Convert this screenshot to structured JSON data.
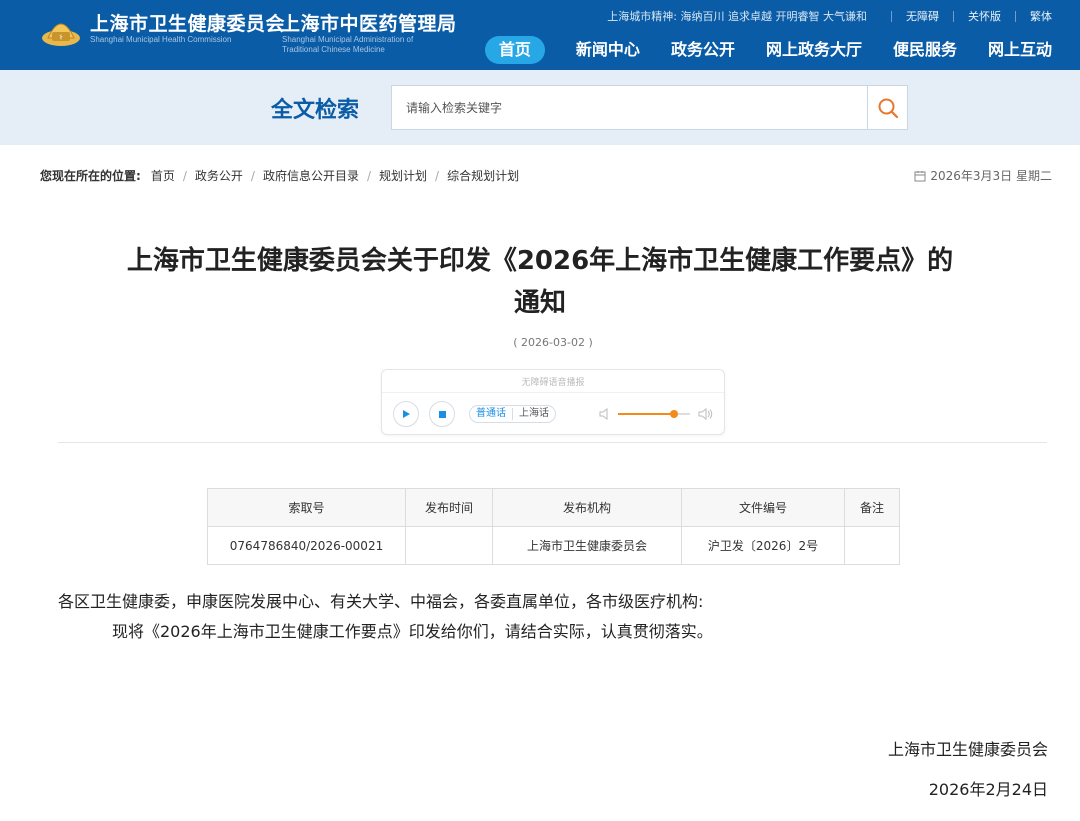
{
  "header": {
    "org_name_1": "上海市卫生健康委员会",
    "org_en_1": "Shanghai Municipal Health Commission",
    "org_name_2": "上海市中医药管理局",
    "org_en_2": "Shanghai Municipal Administration of Traditional Chinese Medicine",
    "slogan": "上海城市精神: 海纳百川 追求卓越 开明睿智 大气谦和",
    "links": [
      "无障碍",
      "关怀版",
      "繁体"
    ],
    "nav": [
      "首页",
      "新闻中心",
      "政务公开",
      "网上政务大厅",
      "便民服务",
      "网上互动"
    ],
    "brand_color": "#0a5ca6",
    "active_nav_color": "#27a7e6"
  },
  "search": {
    "label": "全文检索",
    "placeholder": "请输入检索关键字",
    "button_icon": "search-icon"
  },
  "breadcrumb": {
    "prefix": "您现在所在的位置:",
    "items": [
      "首页",
      "政务公开",
      "政府信息公开目录",
      "规划计划",
      "综合规划计划"
    ]
  },
  "date_display": "2026年3月3日 星期二",
  "article": {
    "title": "上海市卫生健康委员会关于印发《2026年上海市卫生健康工作要点》的通知",
    "date": "( 2026-03-02 )",
    "addressees": "各区卫生健康委，申康医院发展中心、有关大学、中福会，各委直属单位，各市级医疗机构:",
    "body": "现将《2026年上海市卫生健康工作要点》印发给你们，请结合实际，认真贯彻落实。",
    "signature_org": "上海市卫生健康委员会",
    "signature_date": "2026年2月24日"
  },
  "player": {
    "label": "无障碍语音播报",
    "languages": [
      "普通话",
      "上海话"
    ],
    "active_language": "普通话",
    "volume": 0.78,
    "accent_color": "#f28a1c"
  },
  "meta_table": {
    "headers": [
      "索取号",
      "发布时间",
      "发布机构",
      "文件编号",
      "备注"
    ],
    "rows": [
      [
        "0764786840/2026-00021",
        "",
        "上海市卫生健康委员会",
        "沪卫发〔2026〕2号",
        ""
      ]
    ]
  }
}
